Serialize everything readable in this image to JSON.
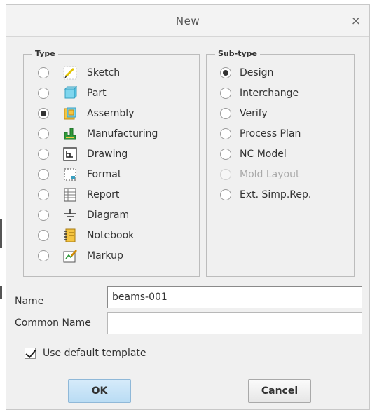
{
  "dialog": {
    "title": "New",
    "close_glyph": "×"
  },
  "type_group": {
    "legend": "Type",
    "items": [
      {
        "label": "Sketch",
        "icon": "sketch-icon",
        "checked": false
      },
      {
        "label": "Part",
        "icon": "part-icon",
        "checked": false
      },
      {
        "label": "Assembly",
        "icon": "assembly-icon",
        "checked": true
      },
      {
        "label": "Manufacturing",
        "icon": "manufacturing-icon",
        "checked": false
      },
      {
        "label": "Drawing",
        "icon": "drawing-icon",
        "checked": false
      },
      {
        "label": "Format",
        "icon": "format-icon",
        "checked": false
      },
      {
        "label": "Report",
        "icon": "report-icon",
        "checked": false
      },
      {
        "label": "Diagram",
        "icon": "diagram-icon",
        "checked": false
      },
      {
        "label": "Notebook",
        "icon": "notebook-icon",
        "checked": false
      },
      {
        "label": "Markup",
        "icon": "markup-icon",
        "checked": false
      }
    ]
  },
  "subtype_group": {
    "legend": "Sub-type",
    "items": [
      {
        "label": "Design",
        "checked": true,
        "disabled": false
      },
      {
        "label": "Interchange",
        "checked": false,
        "disabled": false
      },
      {
        "label": "Verify",
        "checked": false,
        "disabled": false
      },
      {
        "label": "Process Plan",
        "checked": false,
        "disabled": false
      },
      {
        "label": "NC Model",
        "checked": false,
        "disabled": false
      },
      {
        "label": "Mold Layout",
        "checked": false,
        "disabled": true
      },
      {
        "label": "Ext. Simp.Rep.",
        "checked": false,
        "disabled": false
      }
    ]
  },
  "fields": {
    "name_label": "Name",
    "name_value": "beams-001",
    "common_name_label": "Common Name",
    "common_name_value": ""
  },
  "template": {
    "label": "Use default template",
    "checked": true
  },
  "buttons": {
    "ok": "OK",
    "cancel": "Cancel"
  },
  "colors": {
    "ok_button": "#b9dcf4",
    "dialog_bg": "#f0f0f0",
    "border": "#bcbcbc"
  }
}
